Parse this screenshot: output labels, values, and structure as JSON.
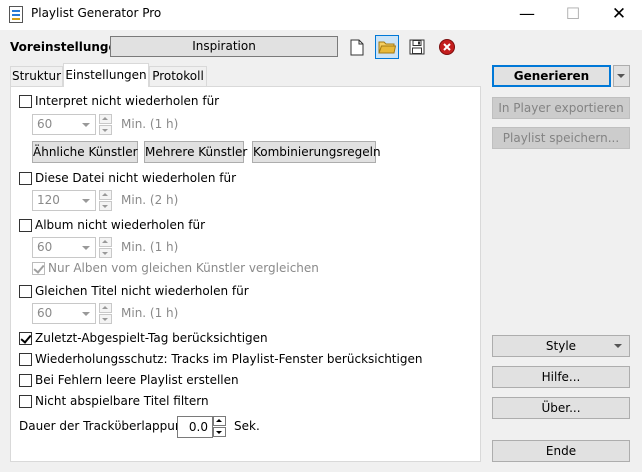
{
  "window": {
    "title": "Playlist Generator Pro",
    "min_glyph": "—",
    "max_glyph": "☐",
    "close_glyph": "✕"
  },
  "presets": {
    "label": "Voreinstellungen",
    "value": "Inspiration"
  },
  "tabs": [
    {
      "label": "Struktur"
    },
    {
      "label": "Einstellungen"
    },
    {
      "label": "Protokoll"
    }
  ],
  "settings": {
    "artist": {
      "label": "Interpret nicht wiederholen für",
      "value": "60",
      "unit": "Min.  (1 h)",
      "buttons": [
        "Ähnliche Künstler",
        "Mehrere Künstler",
        "Kombinierungsregeln"
      ]
    },
    "file": {
      "label": "Diese Datei nicht wiederholen für",
      "value": "120",
      "unit": "Min.  (2 h)"
    },
    "album": {
      "label": "Album nicht wiederholen für",
      "value": "60",
      "unit": "Min.  (1 h)",
      "sub_label": "Nur Alben vom gleichen Künstler vergleichen"
    },
    "title": {
      "label": "Gleichen Titel nicht wiederholen für",
      "value": "60",
      "unit": "Min.  (1 h)"
    },
    "last_played": "Zuletzt-Abgespielt-Tag berücksichtigen",
    "repeat_protection": "Wiederholungsschutz: Tracks im Playlist-Fenster berücksichtigen",
    "empty_on_error": "Bei Fehlern leere Playlist erstellen",
    "filter_unplayable": "Nicht abspielbare Titel filtern",
    "overlap": {
      "label": "Dauer der Trackϋberlappung:",
      "value": "0.0",
      "unit": "Sek."
    }
  },
  "side_buttons": {
    "generate": "Generieren",
    "export": "In Player exportieren",
    "save": "Playlist speichern...",
    "style": "Style",
    "help": "Hilfe...",
    "about": "Über...",
    "end": "Ende"
  },
  "colors": {
    "accent": "#0078d7",
    "delete_red": "#c41e1e",
    "folder_yellow": "#e8b93a"
  }
}
